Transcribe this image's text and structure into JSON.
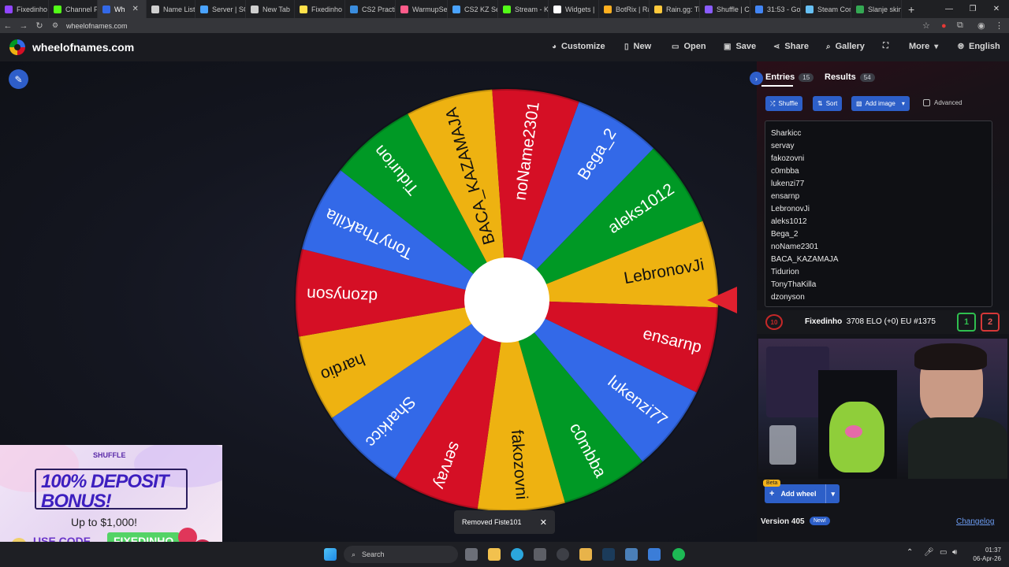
{
  "browser": {
    "tabs": [
      {
        "label": "Fixedinho",
        "color": "#9146ff",
        "w": 62
      },
      {
        "label": "Channel P",
        "color": "#53fc18",
        "w": 62
      },
      {
        "label": "Wh",
        "color": "#3369e8",
        "w": 62,
        "active": true
      },
      {
        "label": "Name List",
        "color": "#cfcfcf",
        "w": 62
      },
      {
        "label": "Server | SC",
        "color": "#4aa3ff",
        "w": 64
      },
      {
        "label": "New Tab",
        "color": "#cfcfcf",
        "w": 62
      },
      {
        "label": "Fixedinho",
        "color": "#ffe14a",
        "w": 64
      },
      {
        "label": "CS2 Practi",
        "color": "#3a8dde",
        "w": 64
      },
      {
        "label": "WarmupSe",
        "color": "#ff5c8a",
        "w": 66
      },
      {
        "label": "CS2 KZ Se",
        "color": "#4aa3ff",
        "w": 64
      },
      {
        "label": "Stream - K",
        "color": "#53fc18",
        "w": 64
      },
      {
        "label": "Widgets |",
        "color": "#ffffff",
        "w": 64
      },
      {
        "label": "BotRix | Ra",
        "color": "#ffb020",
        "w": 64
      },
      {
        "label": "Rain.gg: Ti",
        "color": "#ffc93c",
        "w": 64
      },
      {
        "label": "Shuffle | C",
        "color": "#8a5cff",
        "w": 64
      },
      {
        "label": "31:53 - Go",
        "color": "#4285f4",
        "w": 64
      },
      {
        "label": "Steam Com",
        "color": "#66c0f4",
        "w": 64
      },
      {
        "label": "Slanje skin",
        "color": "#34a853",
        "w": 64
      }
    ],
    "url": "wheelofnames.com"
  },
  "header": {
    "brand": "wheelofnames.com",
    "menu": {
      "customize": "Customize",
      "new": "New",
      "open": "Open",
      "save": "Save",
      "share": "Share",
      "gallery": "Gallery",
      "more": "More",
      "language": "English"
    }
  },
  "wheel": {
    "colors": {
      "blue": "#3369e8",
      "green": "#009925",
      "yellow": "#eeb211",
      "red": "#d50f25"
    },
    "center_color": "#ffffff",
    "segments": [
      {
        "label": "Bega_2",
        "color": "#3369e8"
      },
      {
        "label": "aleks1012",
        "color": "#009925"
      },
      {
        "label": "LebronovJi",
        "color": "#eeb211"
      },
      {
        "label": "ensarnp",
        "color": "#d50f25"
      },
      {
        "label": "lukenzi77",
        "color": "#3369e8"
      },
      {
        "label": "c0mbba",
        "color": "#009925"
      },
      {
        "label": "fakozovni",
        "color": "#eeb211"
      },
      {
        "label": "servay",
        "color": "#d50f25"
      },
      {
        "label": "Sharkicc",
        "color": "#3369e8"
      },
      {
        "label": "hardio",
        "color": "#eeb211"
      },
      {
        "label": "dzonyson",
        "color": "#d50f25"
      },
      {
        "label": "TonyThaKilla",
        "color": "#3369e8"
      },
      {
        "label": "Tidurion",
        "color": "#009925"
      },
      {
        "label": "BACA_KAZAMAJA",
        "color": "#eeb211"
      },
      {
        "label": "noName2301",
        "color": "#d50f25"
      }
    ]
  },
  "panel": {
    "tabs": {
      "entries_label": "Entries",
      "entries_count": "15",
      "results_label": "Results",
      "results_count": "54"
    },
    "tools": {
      "shuffle": "Shuffle",
      "sort": "Sort",
      "add_image": "Add image",
      "advanced": "Advanced"
    },
    "entries": [
      "Sharkicc",
      "servay",
      "fakozovni",
      "c0mbba",
      "lukenzi77",
      "ensarnp",
      "LebronovJi",
      "aleks1012",
      "Bega_2",
      "noName2301",
      "BACA_KAZAMAJA",
      "Tidurion",
      "TonyThaKilla",
      "dzonyson"
    ],
    "add_wheel": "Add wheel",
    "beta": "Beta",
    "version": "Version 405",
    "new_badge": "New!",
    "changelog": "Changelog"
  },
  "overlay": {
    "level": "10",
    "player": "Fixedinho",
    "stats": "3708 ELO (+0) EU #1375",
    "score_left": "1",
    "score_right": "2"
  },
  "toast": {
    "message": "Removed Fiste101",
    "close": "✕"
  },
  "ad": {
    "brand": "SHUFFLE",
    "headline": "100% DEPOSIT BONUS!",
    "subline": "Up to $1,000!",
    "use_code": "USE CODE",
    "code": "FIXEDINHO"
  },
  "taskbar": {
    "search": "Search",
    "time": "01:37",
    "date": "06-Apr-26"
  }
}
